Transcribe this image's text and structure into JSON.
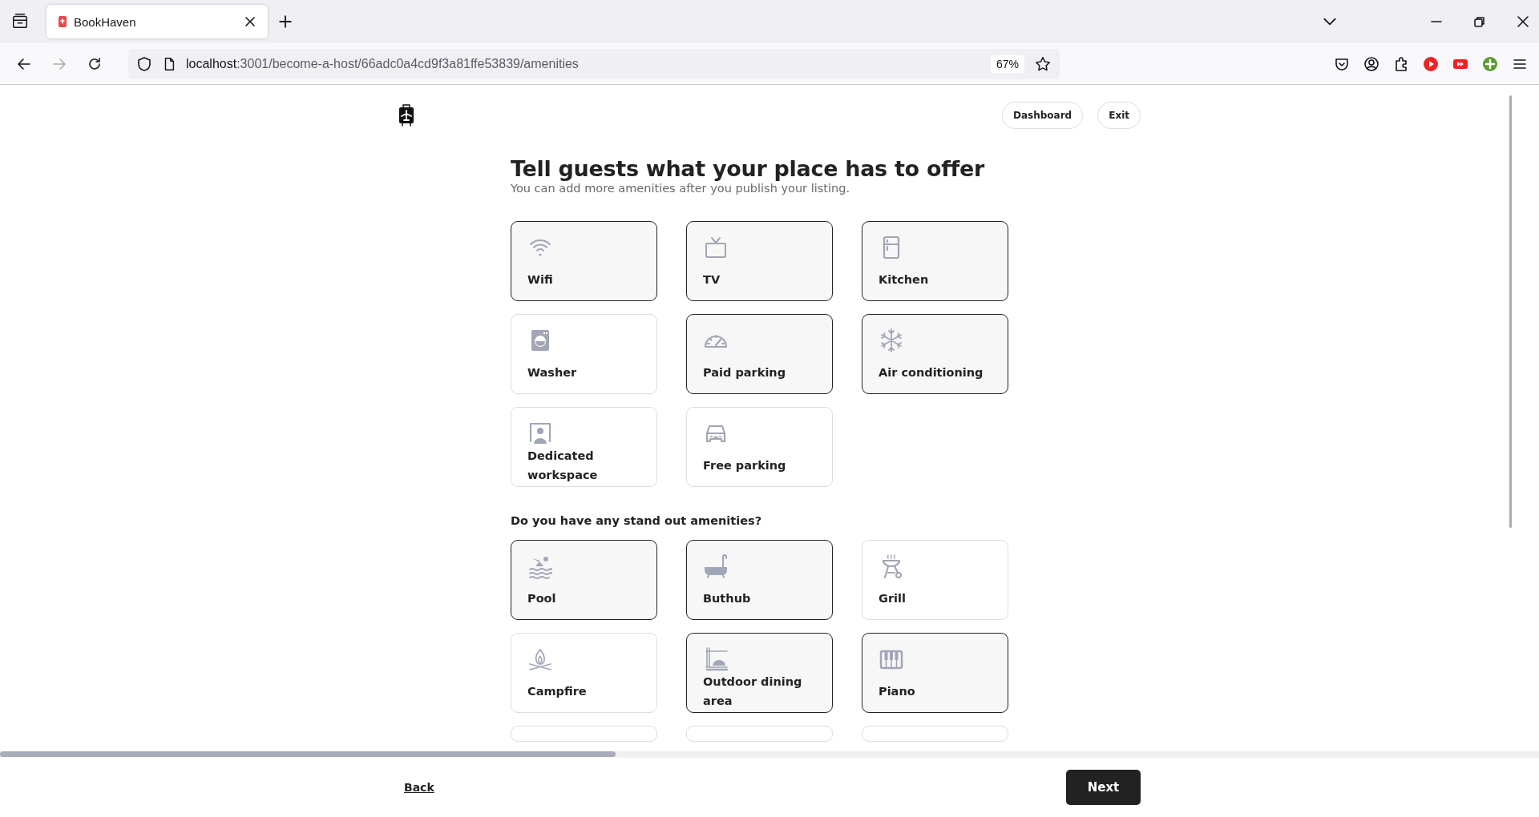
{
  "browser": {
    "tab_title": "BookHaven",
    "url_host": "localhost",
    "url_path": ":3001/become-a-host/66adc0a4cd9f3a81ffe53839/amenities",
    "zoom": "67%"
  },
  "header": {
    "buttons": [
      "Dashboard",
      "Exit"
    ]
  },
  "heading": "Tell guests what your place has to offer",
  "subheading": "You can add more amenities after you publish your listing.",
  "amenities": [
    {
      "kind": "card",
      "label": "Wifi",
      "selected": true
    },
    {
      "kind": "card",
      "label": "TV",
      "selected": true
    },
    {
      "kind": "card",
      "label": "Kitchen",
      "selected": true
    },
    {
      "kind": "card",
      "label": "Washer",
      "selected": false
    },
    {
      "kind": "card",
      "label": "Paid parking",
      "selected": true
    },
    {
      "kind": "card",
      "label": "Air conditioning",
      "selected": true
    },
    {
      "kind": "card",
      "label": "Dedicated workspace",
      "selected": false
    },
    {
      "kind": "card",
      "label": "Free parking",
      "selected": false
    }
  ],
  "standout": {
    "question": "Do you have any stand out amenities?",
    "items": [
      {
        "kind": "card",
        "label": "Pool",
        "selected": true
      },
      {
        "kind": "card",
        "label": "Buthub",
        "selected": true
      },
      {
        "kind": "card",
        "label": "Grill",
        "selected": false
      },
      {
        "kind": "card",
        "label": "Campfire",
        "selected": false
      },
      {
        "kind": "card",
        "label": "Outdoor dining area",
        "selected": true
      },
      {
        "kind": "card",
        "label": "Piano",
        "selected": true
      },
      {
        "kind": "partial",
        "selected": false
      },
      {
        "kind": "partial",
        "selected": false
      },
      {
        "kind": "partial",
        "selected": false
      }
    ]
  },
  "footer": {
    "back": "Back",
    "next": "Next"
  }
}
